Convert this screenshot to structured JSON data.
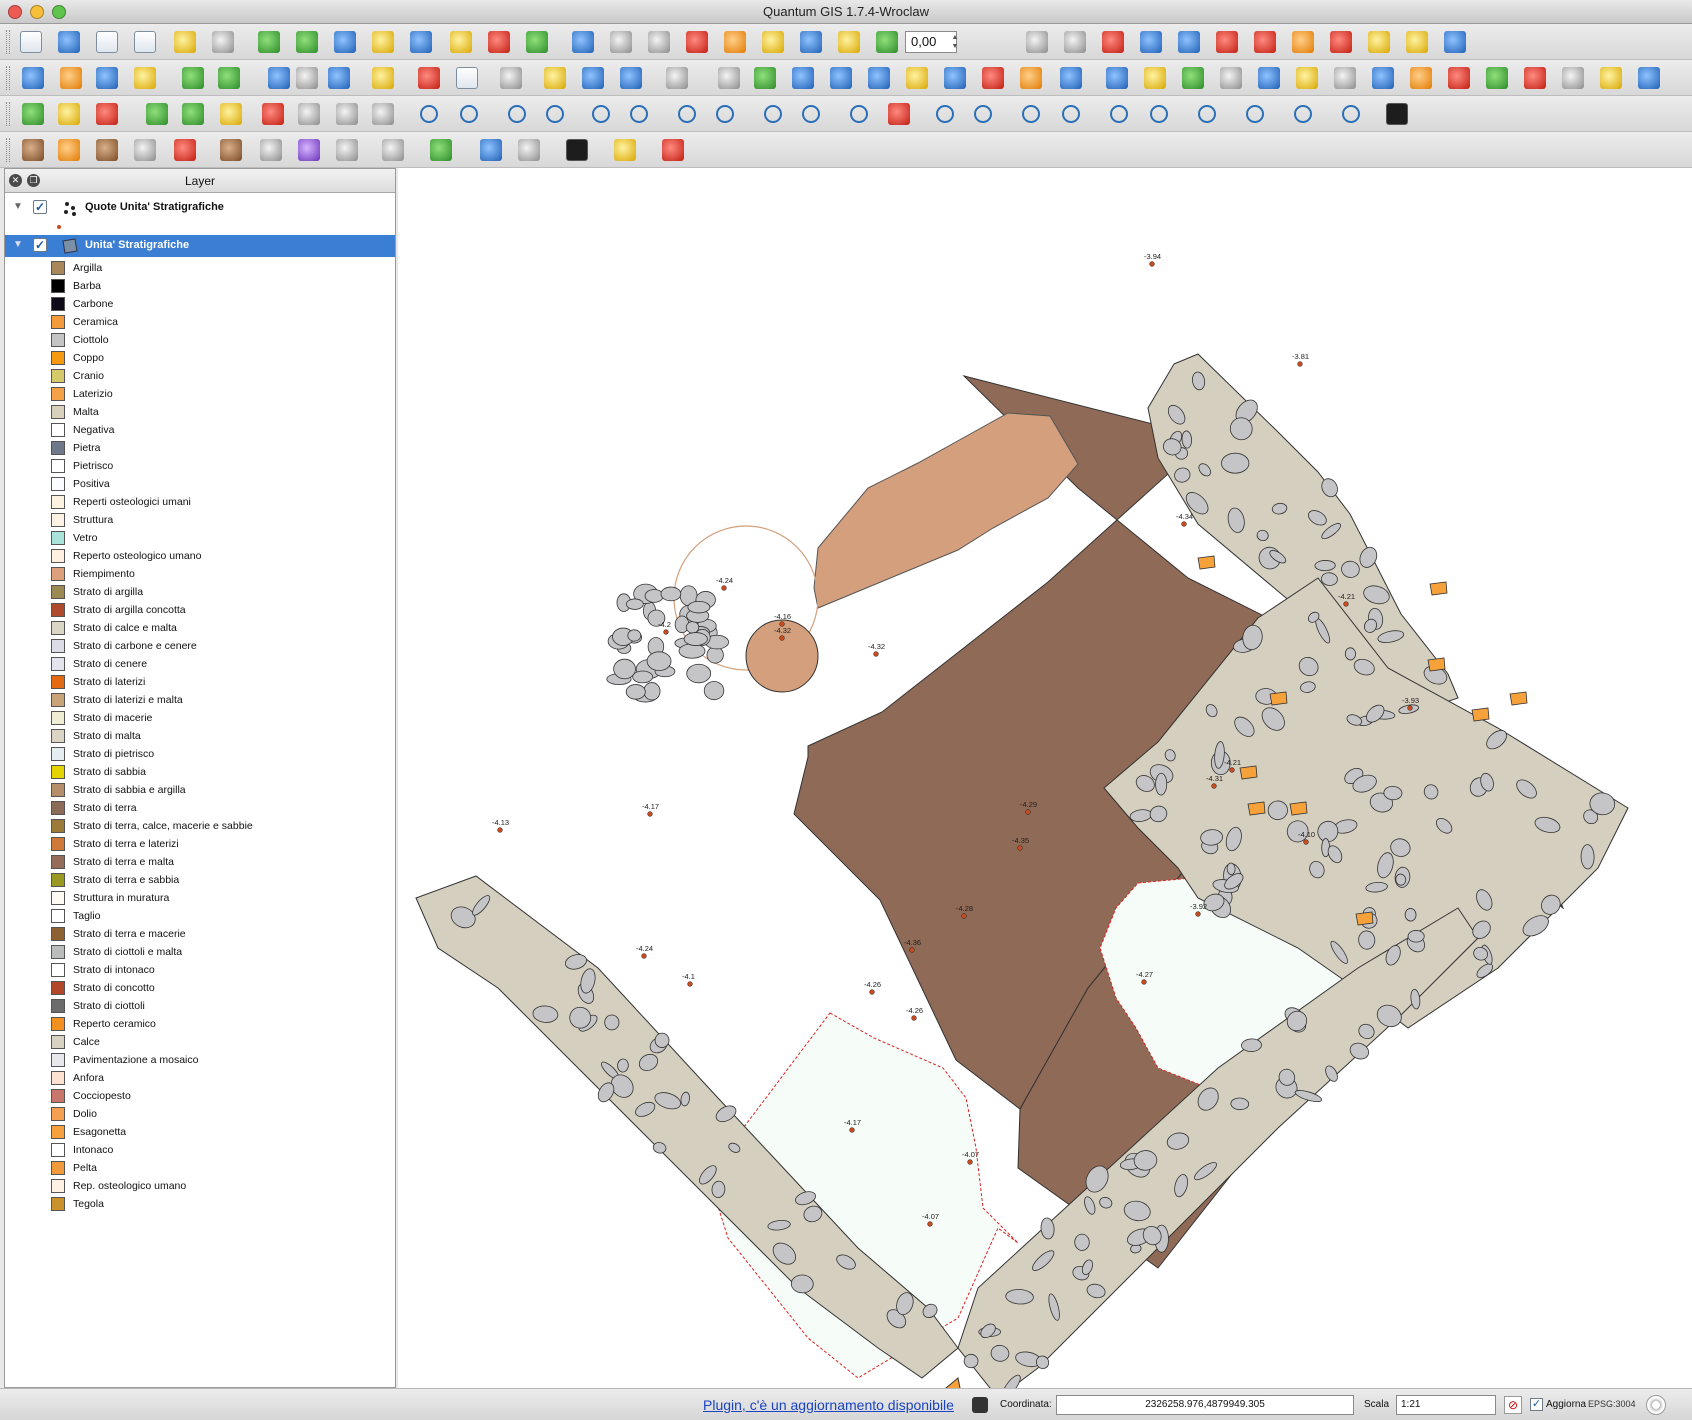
{
  "window": {
    "title": "Quantum GIS 1.7.4-Wroclaw"
  },
  "toolbar": {
    "rotation_value": "0,00"
  },
  "layer_panel": {
    "title": "Layer",
    "layers": [
      {
        "name": "Quote Unita' Stratigrafiche",
        "checked": true
      },
      {
        "name": "Unita' Stratigrafiche",
        "checked": true,
        "selected": true
      }
    ],
    "legend": [
      {
        "label": "Argilla",
        "color": "#a8875a"
      },
      {
        "label": "Barba",
        "color": "#000000"
      },
      {
        "label": "Carbone",
        "color": "#0f0a1a"
      },
      {
        "label": "Ceramica",
        "color": "#f39a3b"
      },
      {
        "label": "Ciottolo",
        "color": "#c4c4c4"
      },
      {
        "label": "Coppo",
        "color": "#f59a12"
      },
      {
        "label": "Cranio",
        "color": "#d6c96a"
      },
      {
        "label": "Laterizio",
        "color": "#f3a24a"
      },
      {
        "label": "Malta",
        "color": "#d8d2bd"
      },
      {
        "label": "Negativa",
        "color": "#ffffff"
      },
      {
        "label": "Pietra",
        "color": "#6e7a8a"
      },
      {
        "label": "Pietrisco",
        "color": "#ffffff"
      },
      {
        "label": "Positiva",
        "color": "#fbfcff"
      },
      {
        "label": "Reperti osteologici umani",
        "color": "#fdf1e0"
      },
      {
        "label": "Struttura",
        "color": "#fff3e6"
      },
      {
        "label": "Vetro",
        "color": "#a9e3d9"
      },
      {
        "label": "Reperto osteologico umano",
        "color": "#fff0e0"
      },
      {
        "label": "Riempimento",
        "color": "#dda07c"
      },
      {
        "label": "Strato di argilla",
        "color": "#9c8a52"
      },
      {
        "label": "Strato di argilla concotta",
        "color": "#b04a2c"
      },
      {
        "label": "Strato di calce e malta",
        "color": "#d9d6c6"
      },
      {
        "label": "Strato di carbone e cenere",
        "color": "#dcdce6"
      },
      {
        "label": "Strato di cenere",
        "color": "#e3e3ec"
      },
      {
        "label": "Strato di laterizi",
        "color": "#e36a12"
      },
      {
        "label": "Strato di laterizi e malta",
        "color": "#c8a478"
      },
      {
        "label": "Strato di macerie",
        "color": "#eeedd2"
      },
      {
        "label": "Strato di malta",
        "color": "#d9d4c4"
      },
      {
        "label": "Strato di pietrisco",
        "color": "#e4eef0"
      },
      {
        "label": "Strato di sabbia",
        "color": "#e6d400"
      },
      {
        "label": "Strato di sabbia e argilla",
        "color": "#b68f6a"
      },
      {
        "label": "Strato di terra",
        "color": "#8d6a56"
      },
      {
        "label": "Strato di terra, calce, macerie e sabbie",
        "color": "#9c7a3a"
      },
      {
        "label": "Strato di terra e laterizi",
        "color": "#d07a3a"
      },
      {
        "label": "Strato di terra e malta",
        "color": "#956c5a"
      },
      {
        "label": "Strato di terra e sabbia",
        "color": "#9a9a22"
      },
      {
        "label": "Struttura in muratura",
        "color": "#fffaf4"
      },
      {
        "label": "Taglio",
        "color": "#ffffff"
      },
      {
        "label": "Strato di terra e macerie",
        "color": "#8e6132"
      },
      {
        "label": "Strato di ciottoli e malta",
        "color": "#b9bcba"
      },
      {
        "label": "Strato di intonaco",
        "color": "#ffffff"
      },
      {
        "label": "Strato di concotto",
        "color": "#b3472a"
      },
      {
        "label": "Strato di ciottoli",
        "color": "#6c6c6c"
      },
      {
        "label": "Reperto ceramico",
        "color": "#f39020"
      },
      {
        "label": "Calce",
        "color": "#d7d2c2"
      },
      {
        "label": "Pavimentazione a mosaico",
        "color": "#e8e8ec"
      },
      {
        "label": "Anfora",
        "color": "#fde2cf"
      },
      {
        "label": "Cocciopesto",
        "color": "#c8776a"
      },
      {
        "label": "Dolio",
        "color": "#f3a050"
      },
      {
        "label": "Esagonetta",
        "color": "#f6a03e"
      },
      {
        "label": "Intonaco",
        "color": "#ffffff"
      },
      {
        "label": "Pelta",
        "color": "#f09a3e"
      },
      {
        "label": "Rep. osteologico umano",
        "color": "#fff2e4"
      },
      {
        "label": "Tegola",
        "color": "#c9922a"
      }
    ]
  },
  "map": {
    "colors": {
      "terra": "#8f6a56",
      "riempimento": "#d39f7d",
      "wall": "#d5cfbf",
      "stone": "#c5c5c8",
      "negativa": "#f6fdf8",
      "ceramica": "#f7a13b",
      "point": "#c84b1e"
    },
    "elevations": [
      {
        "label": "-3.94"
      },
      {
        "label": "-3.81"
      },
      {
        "label": "-4.34"
      },
      {
        "label": "-4.21"
      },
      {
        "label": "-3.93"
      },
      {
        "label": "-4.21"
      },
      {
        "label": "-4.31"
      },
      {
        "label": "-4.10"
      },
      {
        "label": "-3.92"
      },
      {
        "label": "-4.27"
      },
      {
        "label": "-4.07"
      },
      {
        "label": "-4.07"
      },
      {
        "label": "-4.29"
      },
      {
        "label": "-4.35"
      },
      {
        "label": "-4.28"
      },
      {
        "label": "-4.36"
      },
      {
        "label": "-4.26"
      },
      {
        "label": "-4.26"
      },
      {
        "label": "-4.24"
      },
      {
        "label": "-4.16"
      },
      {
        "label": "-4.32"
      },
      {
        "label": "-4.32"
      },
      {
        "label": "-4.2"
      },
      {
        "label": "-4.17"
      },
      {
        "label": "-4.13"
      },
      {
        "label": "-4.24"
      },
      {
        "label": "-4.1"
      },
      {
        "label": "-4.17"
      }
    ]
  },
  "statusbar": {
    "plugin_message": "Plugin, c'è un aggiornamento disponibile",
    "coord_label": "Coordinata:",
    "coord_value": "2326258.976,4879949.305",
    "scale_label": "Scala",
    "scale_value": "1:21",
    "render_label": "Aggiorna",
    "render_checked": true,
    "crs": "EPSG:3004"
  }
}
